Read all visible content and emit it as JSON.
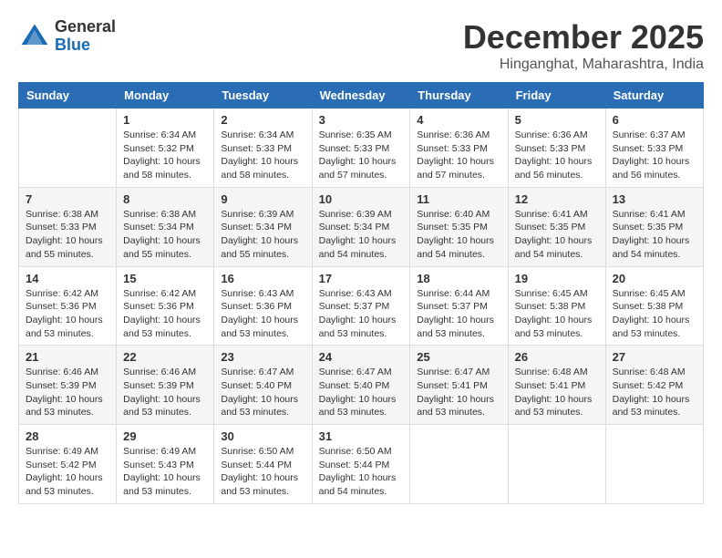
{
  "header": {
    "logo": {
      "line1": "General",
      "line2": "Blue"
    },
    "month": "December 2025",
    "location": "Hinganghat, Maharashtra, India"
  },
  "weekdays": [
    "Sunday",
    "Monday",
    "Tuesday",
    "Wednesday",
    "Thursday",
    "Friday",
    "Saturday"
  ],
  "weeks": [
    [
      {
        "day": "",
        "info": ""
      },
      {
        "day": "1",
        "info": "Sunrise: 6:34 AM\nSunset: 5:32 PM\nDaylight: 10 hours\nand 58 minutes."
      },
      {
        "day": "2",
        "info": "Sunrise: 6:34 AM\nSunset: 5:33 PM\nDaylight: 10 hours\nand 58 minutes."
      },
      {
        "day": "3",
        "info": "Sunrise: 6:35 AM\nSunset: 5:33 PM\nDaylight: 10 hours\nand 57 minutes."
      },
      {
        "day": "4",
        "info": "Sunrise: 6:36 AM\nSunset: 5:33 PM\nDaylight: 10 hours\nand 57 minutes."
      },
      {
        "day": "5",
        "info": "Sunrise: 6:36 AM\nSunset: 5:33 PM\nDaylight: 10 hours\nand 56 minutes."
      },
      {
        "day": "6",
        "info": "Sunrise: 6:37 AM\nSunset: 5:33 PM\nDaylight: 10 hours\nand 56 minutes."
      }
    ],
    [
      {
        "day": "7",
        "info": "Sunrise: 6:38 AM\nSunset: 5:33 PM\nDaylight: 10 hours\nand 55 minutes."
      },
      {
        "day": "8",
        "info": "Sunrise: 6:38 AM\nSunset: 5:34 PM\nDaylight: 10 hours\nand 55 minutes."
      },
      {
        "day": "9",
        "info": "Sunrise: 6:39 AM\nSunset: 5:34 PM\nDaylight: 10 hours\nand 55 minutes."
      },
      {
        "day": "10",
        "info": "Sunrise: 6:39 AM\nSunset: 5:34 PM\nDaylight: 10 hours\nand 54 minutes."
      },
      {
        "day": "11",
        "info": "Sunrise: 6:40 AM\nSunset: 5:35 PM\nDaylight: 10 hours\nand 54 minutes."
      },
      {
        "day": "12",
        "info": "Sunrise: 6:41 AM\nSunset: 5:35 PM\nDaylight: 10 hours\nand 54 minutes."
      },
      {
        "day": "13",
        "info": "Sunrise: 6:41 AM\nSunset: 5:35 PM\nDaylight: 10 hours\nand 54 minutes."
      }
    ],
    [
      {
        "day": "14",
        "info": "Sunrise: 6:42 AM\nSunset: 5:36 PM\nDaylight: 10 hours\nand 53 minutes."
      },
      {
        "day": "15",
        "info": "Sunrise: 6:42 AM\nSunset: 5:36 PM\nDaylight: 10 hours\nand 53 minutes."
      },
      {
        "day": "16",
        "info": "Sunrise: 6:43 AM\nSunset: 5:36 PM\nDaylight: 10 hours\nand 53 minutes."
      },
      {
        "day": "17",
        "info": "Sunrise: 6:43 AM\nSunset: 5:37 PM\nDaylight: 10 hours\nand 53 minutes."
      },
      {
        "day": "18",
        "info": "Sunrise: 6:44 AM\nSunset: 5:37 PM\nDaylight: 10 hours\nand 53 minutes."
      },
      {
        "day": "19",
        "info": "Sunrise: 6:45 AM\nSunset: 5:38 PM\nDaylight: 10 hours\nand 53 minutes."
      },
      {
        "day": "20",
        "info": "Sunrise: 6:45 AM\nSunset: 5:38 PM\nDaylight: 10 hours\nand 53 minutes."
      }
    ],
    [
      {
        "day": "21",
        "info": "Sunrise: 6:46 AM\nSunset: 5:39 PM\nDaylight: 10 hours\nand 53 minutes."
      },
      {
        "day": "22",
        "info": "Sunrise: 6:46 AM\nSunset: 5:39 PM\nDaylight: 10 hours\nand 53 minutes."
      },
      {
        "day": "23",
        "info": "Sunrise: 6:47 AM\nSunset: 5:40 PM\nDaylight: 10 hours\nand 53 minutes."
      },
      {
        "day": "24",
        "info": "Sunrise: 6:47 AM\nSunset: 5:40 PM\nDaylight: 10 hours\nand 53 minutes."
      },
      {
        "day": "25",
        "info": "Sunrise: 6:47 AM\nSunset: 5:41 PM\nDaylight: 10 hours\nand 53 minutes."
      },
      {
        "day": "26",
        "info": "Sunrise: 6:48 AM\nSunset: 5:41 PM\nDaylight: 10 hours\nand 53 minutes."
      },
      {
        "day": "27",
        "info": "Sunrise: 6:48 AM\nSunset: 5:42 PM\nDaylight: 10 hours\nand 53 minutes."
      }
    ],
    [
      {
        "day": "28",
        "info": "Sunrise: 6:49 AM\nSunset: 5:42 PM\nDaylight: 10 hours\nand 53 minutes."
      },
      {
        "day": "29",
        "info": "Sunrise: 6:49 AM\nSunset: 5:43 PM\nDaylight: 10 hours\nand 53 minutes."
      },
      {
        "day": "30",
        "info": "Sunrise: 6:50 AM\nSunset: 5:44 PM\nDaylight: 10 hours\nand 53 minutes."
      },
      {
        "day": "31",
        "info": "Sunrise: 6:50 AM\nSunset: 5:44 PM\nDaylight: 10 hours\nand 54 minutes."
      },
      {
        "day": "",
        "info": ""
      },
      {
        "day": "",
        "info": ""
      },
      {
        "day": "",
        "info": ""
      }
    ]
  ]
}
